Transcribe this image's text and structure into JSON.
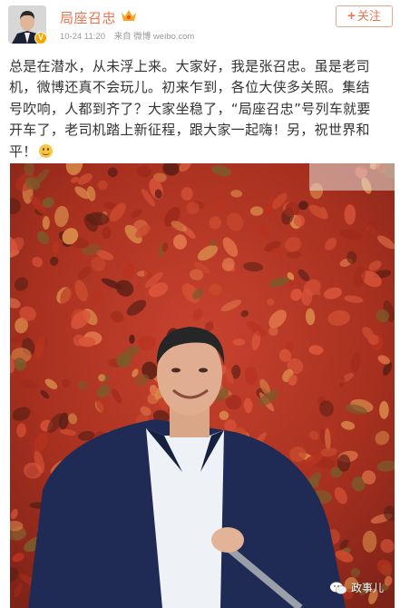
{
  "post": {
    "author": "局座召忠",
    "timestamp": "10-24 11:20",
    "source": "来自 微博 weibo.com",
    "follow_label": "关注",
    "text_lines": [
      "总是在潜水，从未浮上来。大家好，我是张召忠。虽是老司",
      "机，微博还真不会玩儿。初来乍到，各位大侠多关照。集结",
      "号吹响，人都到齐了？大家坐稳了，“局座召忠”号列车就要",
      "开车了，老司机踏上新征程，跟大家一起嗨！另，祝世界和",
      "平！"
    ]
  },
  "watermark": {
    "label": "政事儿"
  },
  "colors": {
    "accent": "#eb7350",
    "meta": "#999999",
    "verified": "#f6a800"
  },
  "icons": [
    "avatar",
    "verified-badge-icon",
    "crown-icon",
    "plus-icon",
    "smile-emoji-icon",
    "wechat-icon"
  ]
}
